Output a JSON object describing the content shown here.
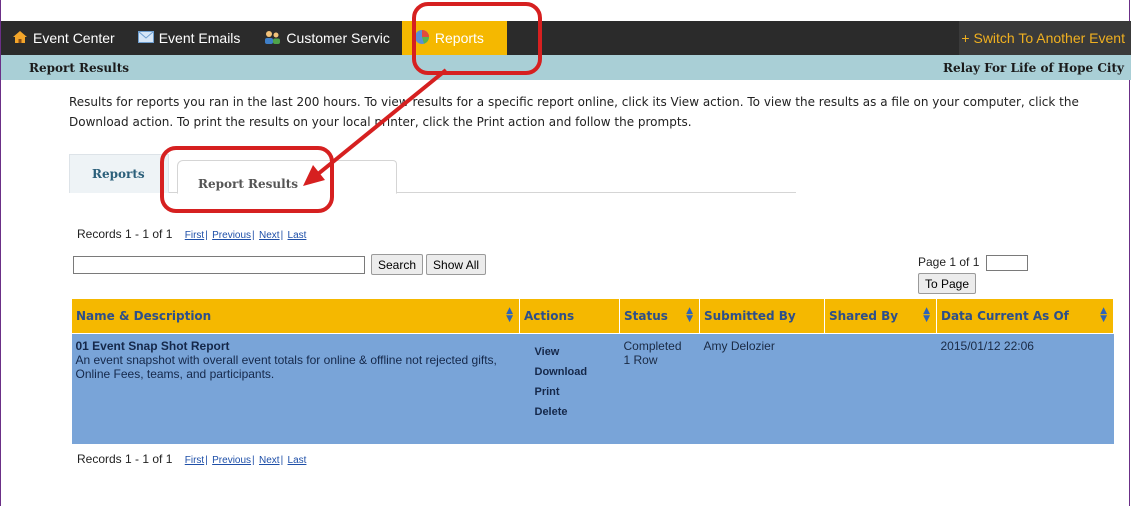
{
  "nav": {
    "items": [
      {
        "label": "Event Center",
        "icon": "home-icon"
      },
      {
        "label": "Event Emails",
        "icon": "envelope-icon"
      },
      {
        "label": "Customer Servic",
        "icon": "people-icon"
      },
      {
        "label": "Reports",
        "icon": "chart-icon"
      }
    ],
    "switch_label": "+ Switch To Another Event"
  },
  "subbar": {
    "title": "Report Results",
    "event_name": "Relay For Life of Hope City"
  },
  "intro": "Results for reports you ran in the last 200 hours. To view results for a specific report online, click its View action. To view the results as a file on your computer, click the Download action. To print the results on your local printer, click the Print action and follow the prompts.",
  "tabs": {
    "reports": "Reports",
    "results": "Report Results"
  },
  "records": {
    "label": "Records 1 - 1 of 1",
    "first": "First",
    "previous": "Previous",
    "next": "Next",
    "last": "Last",
    "sep": "|"
  },
  "search": {
    "value": "",
    "search_label": "Search",
    "show_all_label": "Show All"
  },
  "pager": {
    "label": "Page 1 of 1",
    "button": "To Page"
  },
  "table": {
    "headers": [
      "Name & Description",
      "Actions",
      "Status",
      "Submitted By",
      "Shared By",
      "Data Current As Of"
    ],
    "row": {
      "title": "01 Event Snap Shot Report",
      "description": "An event snapshot with overall event totals for online & offline not rejected gifts, Online Fees, teams, and participants.",
      "actions": [
        "View",
        "Download",
        "Print",
        "Delete"
      ],
      "status": "Completed",
      "status_rows": "1 Row",
      "submitted_by": "Amy Delozier",
      "shared_by": "",
      "data_current": "2015/01/12 22:06"
    }
  },
  "colors": {
    "nav_bg": "#2b2b2b",
    "accent": "#f5b800",
    "subbar": "#a9cfd6",
    "row_bg": "#79a4d8",
    "annotation": "#d62020"
  }
}
